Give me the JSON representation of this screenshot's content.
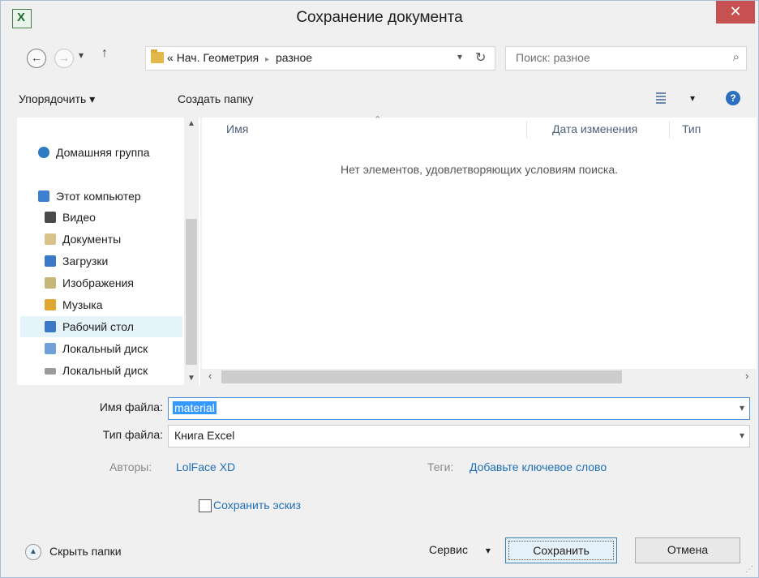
{
  "window": {
    "title": "Сохранение документа",
    "close_glyph": "✕",
    "app_icon": "excel-icon"
  },
  "navigation": {
    "back_glyph": "←",
    "forward_glyph": "→",
    "recent_glyph": "▾",
    "up_glyph": "↑",
    "address": {
      "chevron": "«",
      "path": [
        "Нач. Геометрия",
        "разное"
      ],
      "separator": "▸"
    },
    "search_placeholder": "Поиск: разное"
  },
  "toolbar": {
    "organize": "Упорядочить ▾",
    "new_folder": "Создать папку",
    "view_dropdown": "▾"
  },
  "sidebar": {
    "items": [
      {
        "label": "Домашняя группа",
        "icon": "homegroup-icon",
        "color": "#2d7bc4"
      },
      {
        "label": "Этот компьютер",
        "icon": "computer-icon",
        "color": "#3d7fd0"
      },
      {
        "label": "Видео",
        "icon": "video-folder-icon",
        "color": "#4a4a4a"
      },
      {
        "label": "Документы",
        "icon": "documents-folder-icon",
        "color": "#d9c38a"
      },
      {
        "label": "Загрузки",
        "icon": "downloads-folder-icon",
        "color": "#3a79c7"
      },
      {
        "label": "Изображения",
        "icon": "pictures-folder-icon",
        "color": "#c7b67a"
      },
      {
        "label": "Музыка",
        "icon": "music-folder-icon",
        "color": "#e0a830"
      },
      {
        "label": "Рабочий стол",
        "icon": "desktop-folder-icon",
        "color": "#3a79c7",
        "selected": true
      },
      {
        "label": "Локальный диск",
        "icon": "local-disk-icon",
        "color": "#6fa0d8"
      },
      {
        "label": "Локальный диск",
        "icon": "local-disk-icon",
        "color": "#9a9a9a"
      }
    ]
  },
  "file_list": {
    "columns": [
      "Имя",
      "Дата изменения",
      "Тип"
    ],
    "empty_message": "Нет элементов, удовлетворяющих условиям поиска."
  },
  "form": {
    "filename_label": "Имя файла:",
    "filename_value": "material",
    "filetype_label": "Тип файла:",
    "filetype_value": "Книга Excel",
    "authors_label": "Авторы:",
    "authors_value": "LolFace XD",
    "tags_label": "Теги:",
    "tags_placeholder": "Добавьте ключевое слово",
    "thumbnail_label": "Сохранить эскиз"
  },
  "footer": {
    "hide_folders": "Скрыть папки",
    "tools": "Сервис",
    "tools_arrow": "▾",
    "save": "Сохранить",
    "cancel": "Отмена"
  },
  "colors": {
    "accent": "#3399ff",
    "link": "#1e6fb9",
    "close": "#c75050"
  }
}
